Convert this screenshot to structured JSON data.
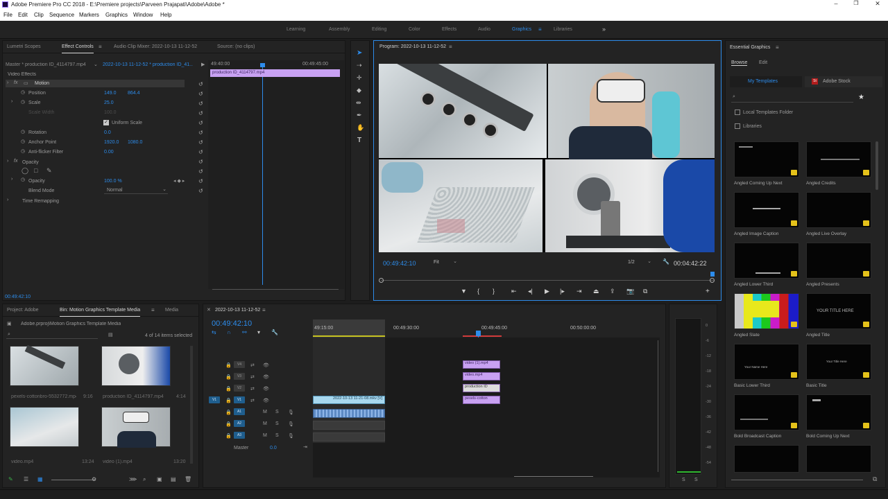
{
  "window": {
    "title": "Adobe Premiere Pro CC 2018 - E:\\Premiere projects\\Parveen Prajapati\\Adobe\\Adobe *"
  },
  "menu": [
    "File",
    "Edit",
    "Clip",
    "Sequence",
    "Markers",
    "Graphics",
    "Window",
    "Help"
  ],
  "workspaces": [
    {
      "label": "Learning"
    },
    {
      "label": "Assembly"
    },
    {
      "label": "Editing"
    },
    {
      "label": "Color"
    },
    {
      "label": "Effects"
    },
    {
      "label": "Audio"
    },
    {
      "label": "Graphics",
      "active": true
    },
    {
      "label": "Libraries"
    }
  ],
  "effect_panel": {
    "tabs": [
      "Lumetri Scopes",
      "Effect Controls",
      "Audio Clip Mixer: 2022-10-13 11-12-52",
      "Source: (no clips)"
    ],
    "master": "Master * production ID_4114797.mp4",
    "sequence_clip": "2022-10-13 11-12-52 * production ID_41...",
    "ruler_start": "49:40:00",
    "ruler_end": "00:49:45:00",
    "clip_name": "production ID_4114797.mp4",
    "video_effects": "Video Effects",
    "motion": "Motion",
    "position_label": "Position",
    "position_x": "149.0",
    "position_y": "864.4",
    "scale_label": "Scale",
    "scale_value": "25.0",
    "scale_width_label": "Scale Width",
    "scale_width_value": "100.0",
    "uniform_scale": "Uniform Scale",
    "rotation_label": "Rotation",
    "rotation_value": "0.0",
    "anchor_label": "Anchor Point",
    "anchor_x": "1920.0",
    "anchor_y": "1080.0",
    "flicker_label": "Anti-flicker Filter",
    "flicker_value": "0.00",
    "opacity_group": "Opacity",
    "opacity_label": "Opacity",
    "opacity_value": "100.0 %",
    "blend_label": "Blend Mode",
    "blend_value": "Normal",
    "time_remap": "Time Remapping",
    "timecode": "00:49:42:10"
  },
  "program_monitor": {
    "title": "Program: 2022-10-13 11-12-52",
    "timecode": "00:49:42:10",
    "fit": "Fit",
    "resolution": "1/2",
    "duration": "00:04:42:22"
  },
  "project_panel": {
    "tabs": [
      "Project: Adobe",
      "Bin: Motion Graphics Template Media",
      "Media"
    ],
    "path": "Adobe.prproj\\Motion Graphics Template Media",
    "count": "4 of 14 items selected",
    "items": [
      {
        "name": "pexels-cottonbro-5532772.mp4",
        "duration": "9:16"
      },
      {
        "name": "production ID_4114797.mp4",
        "duration": "4:14"
      },
      {
        "name": "video.mp4",
        "duration": "13:24"
      },
      {
        "name": "video (1).mp4",
        "duration": "13:20"
      }
    ]
  },
  "timeline": {
    "sequence": "2022-10-13 11-12-52",
    "timecode": "00:49:42:10",
    "ruler": [
      "49:15:00",
      "00:49:30:00",
      "00:49:45:00",
      "00:50:00:00"
    ],
    "tracks": [
      "V4",
      "V3",
      "V2",
      "V1",
      "A1",
      "A2",
      "A3"
    ],
    "source_v": "V1",
    "source_a": "A1",
    "master": "Master",
    "master_value": "0.0",
    "clips": [
      {
        "name": "video (1).mp4"
      },
      {
        "name": "video.mp4"
      },
      {
        "name": "production ID"
      },
      {
        "name": "pexels-cotton"
      },
      {
        "name": "2022-10-13 11-21-08.mkv [V]"
      }
    ]
  },
  "audio_meter": {
    "scale": [
      "0",
      "-6",
      "-12",
      "-18",
      "-24",
      "-30",
      "-36",
      "-42",
      "-48",
      "-54"
    ],
    "solo": "S"
  },
  "essential_graphics": {
    "title": "Essential Graphics",
    "tabs": [
      "Browse",
      "Edit"
    ],
    "my_templates": "My Templates",
    "adobe_stock": "Adobe Stock",
    "local_folder": "Local Templates Folder",
    "libraries": "Libraries",
    "templates": [
      {
        "name": "Angled Coming Up Next"
      },
      {
        "name": "Angled Credits"
      },
      {
        "name": "Angled Image Caption"
      },
      {
        "name": "Angled Live Overlay"
      },
      {
        "name": "Angled Lower Third"
      },
      {
        "name": "Angled Presents"
      },
      {
        "name": "Angled Slate"
      },
      {
        "name": "Angled Title"
      },
      {
        "name": "Basic Lower Third"
      },
      {
        "name": "Basic Title"
      },
      {
        "name": "Bold Broadcast Caption"
      },
      {
        "name": "Bold Coming Up Next"
      }
    ],
    "title_preview": "YOUR TITLE HERE",
    "basic_title_preview": "Your Title Here",
    "basic_lower_preview": "Your Name Here"
  },
  "colors": {
    "accent": "#2d8ceb",
    "clip_video": "#c8a1f2",
    "clip_audio": "#5d8ac4",
    "panel": "#232323"
  }
}
